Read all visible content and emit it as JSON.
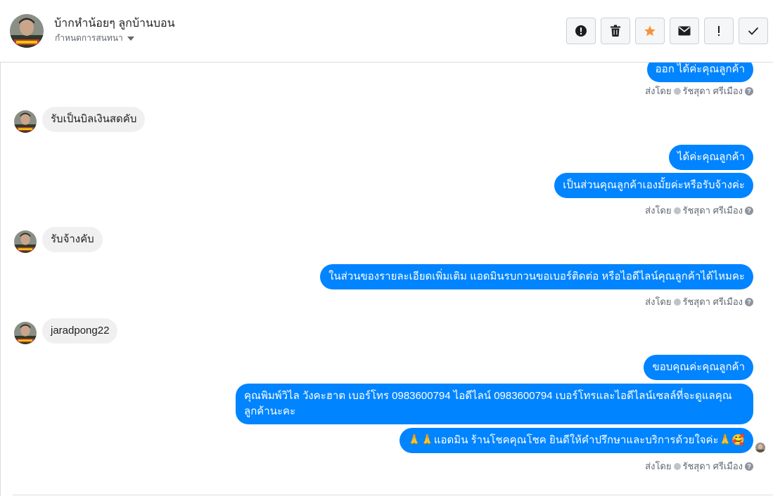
{
  "header": {
    "name": "บ้ากหำน้อยๆ ลูกบ้านบอน",
    "subtitle": "กำหนดการสนทนา",
    "actions": [
      {
        "icon": "alert-circle-icon"
      },
      {
        "icon": "trash-icon"
      },
      {
        "icon": "star-icon"
      },
      {
        "icon": "envelope-icon"
      },
      {
        "icon": "exclamation-icon"
      },
      {
        "icon": "check-icon"
      }
    ]
  },
  "colors": {
    "outgoing_bubble": "#0084ff",
    "incoming_bubble": "#f1f0f0",
    "star_accent": "#f7923b"
  },
  "messages": {
    "m1": "ออก ได้ค่ะคุณลูกค้า",
    "m2": "รับเป็นบิลเงินสดคับ",
    "m3": "ได้ค่ะคุณลูกค้า",
    "m4": "เป็นส่วนคุณลูกค้าเองมั้ยค่ะหรือรับจ้างค่ะ",
    "m5": "รับจ้างคับ",
    "m6": "ในส่วนของรายละเอียดเพิ่มเติม แอดมินรบกวนขอเบอร์ติดต่อ หรือไอดีไลน์คุณลูกค้าได้ไหมคะ",
    "m7": "jaradpong22",
    "m8": "ขอบคุณค่ะคุณลูกค้า",
    "m9": "คุณพิมพ์วิไล วังคะฮาต   เบอร์โทร 0983600794  ไอดีไลน์ 0983600794  เบอร์โทรและไอดีไลน์เซลล์ที่จะดูแลคุณลูกค้านะคะ",
    "m10": "🙏🙏แอดมิน ร้านโชคคุณโชค ยินดีให้คำปรึกษาและบริการด้วยใจค่ะ🙏🥰"
  },
  "sent_by": {
    "prefix": "ส่งโดย",
    "agent": "รัชสุดา ศรีเมือง"
  }
}
